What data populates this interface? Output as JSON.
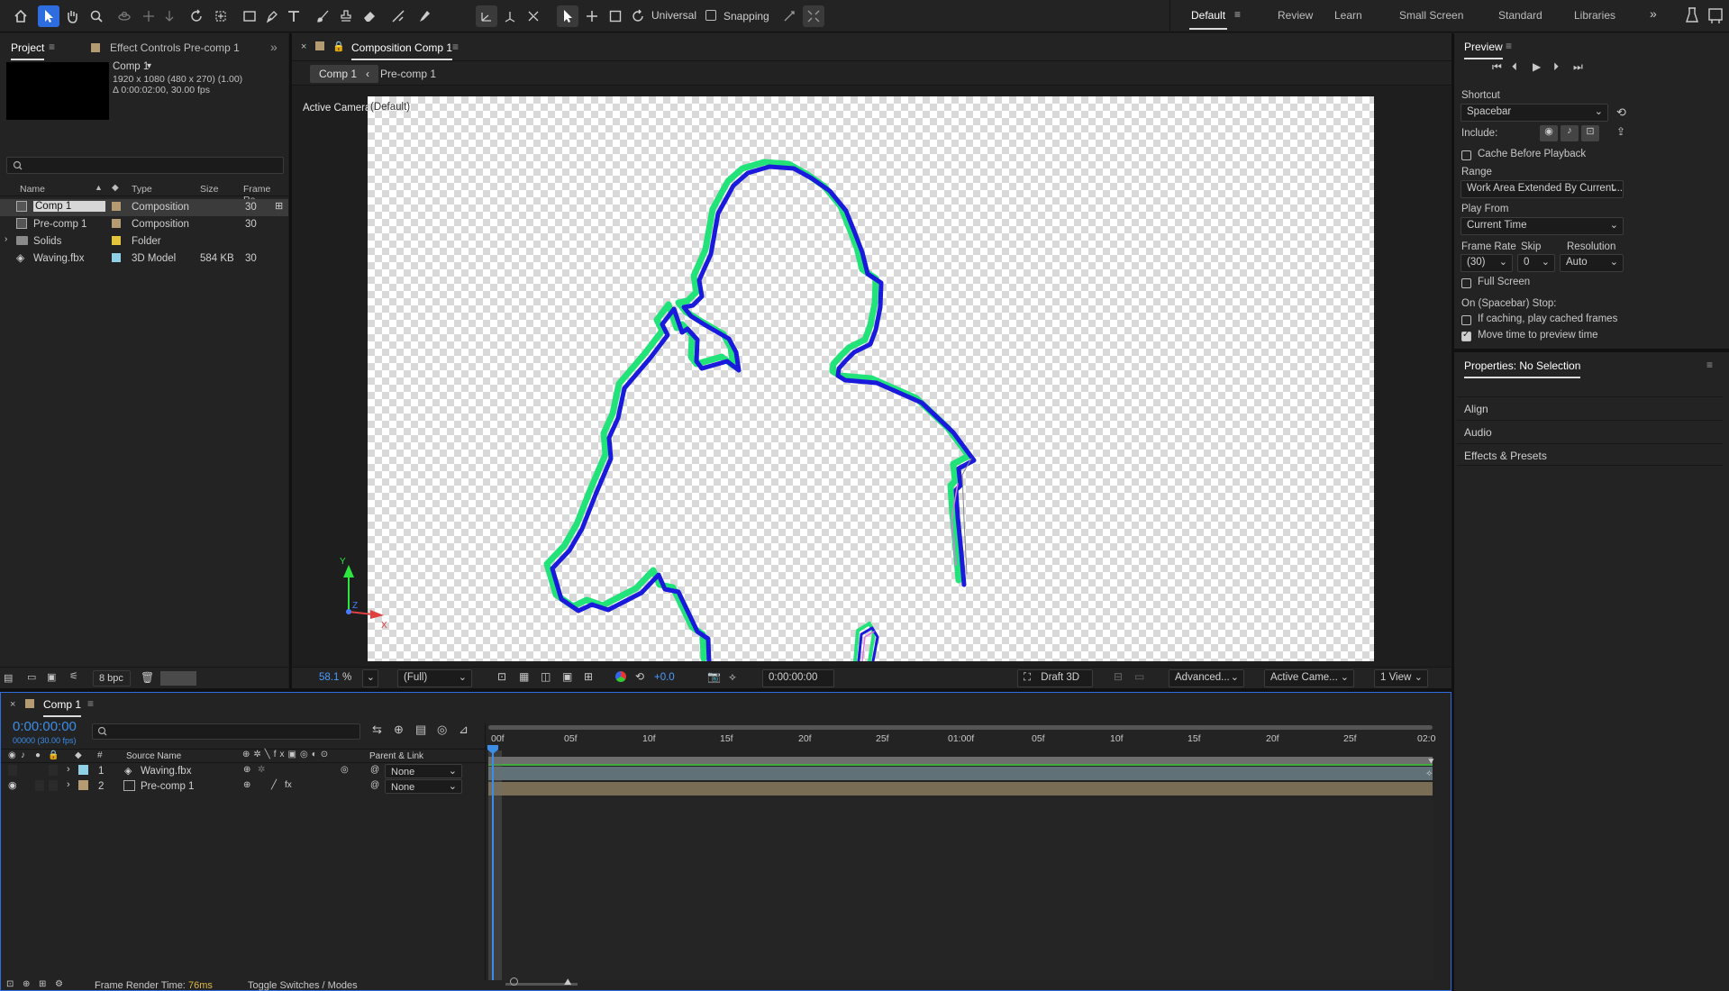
{
  "toolbar": {
    "tool_icons": [
      "home-icon",
      "selection-tool-icon",
      "hand-tool-icon",
      "zoom-tool-icon",
      "orbit-tool-icon",
      "pan-tool-icon",
      "dolly-tool-icon",
      "rotate-tool-icon",
      "pan-behind-tool-icon",
      "rectangle-tool-icon",
      "pen-tool-icon",
      "type-tool-icon",
      "brush-tool-icon",
      "clone-stamp-icon",
      "eraser-icon",
      "roto-brush-icon",
      "puppet-tool-icon"
    ],
    "axis_label": "Universal",
    "snapping_label": "Snapping",
    "workspaces": [
      "Default",
      "Review",
      "Learn",
      "Small Screen",
      "Standard",
      "Libraries"
    ],
    "current_workspace": "Default"
  },
  "project": {
    "tab_label": "Project",
    "effect_controls_label": "Effect Controls Pre-comp 1",
    "comp_name": "Comp 1",
    "comp_res": "1920 x 1080  (480 x 270) (1.00)",
    "comp_dur": "Δ 0:00:02:00, 30.00 fps",
    "columns": {
      "name": "Name",
      "type": "Type",
      "size": "Size",
      "frame_rate": "Frame Ra.."
    },
    "items": [
      {
        "name": "Comp 1",
        "type": "Composition",
        "size": "",
        "fps": "30",
        "color": "#b59b72"
      },
      {
        "name": "Pre-comp 1",
        "type": "Composition",
        "size": "",
        "fps": "30",
        "color": "#b59b72"
      },
      {
        "name": "Solids",
        "type": "Folder",
        "size": "",
        "fps": "",
        "color": "#e3c53c"
      },
      {
        "name": "Waving.fbx",
        "type": "3D Model",
        "size": "584 KB",
        "fps": "30",
        "color": "#8fd0e6"
      }
    ],
    "bpc": "8 bpc"
  },
  "composition": {
    "tab_label": "Composition Comp 1",
    "breadcrumbs": [
      "Comp 1",
      "Pre-comp 1"
    ],
    "camera_label": "Active Camera",
    "camera_sub": "(Default)",
    "zoom": "58.1",
    "zoom_unit": "%",
    "resolution": "(Full)",
    "exposure": "+0.0",
    "timecode": "0:00:00:00",
    "renderer": "Draft 3D",
    "renderer_mode": "Advanced...",
    "camera_select": "Active Came...",
    "view_count": "1 View",
    "axis_x": "X",
    "axis_y": "Y",
    "axis_z": "Z"
  },
  "preview": {
    "title": "Preview",
    "shortcut_label": "Shortcut",
    "shortcut_value": "Spacebar",
    "include_label": "Include:",
    "cache_label": "Cache Before Playback",
    "range_label": "Range",
    "range_value": "Work Area Extended By Current...",
    "play_from_label": "Play From",
    "play_from_value": "Current Time",
    "frame_rate_label": "Frame Rate",
    "skip_label": "Skip",
    "resolution_label": "Resolution",
    "frame_rate_value": "(30)",
    "skip_value": "0",
    "resolution_value": "Auto",
    "full_screen_label": "Full Screen",
    "stop_label": "On (Spacebar) Stop:",
    "if_caching_label": "If caching, play cached frames",
    "move_time_label": "Move time to preview time",
    "cache_checked": false,
    "full_screen_checked": false,
    "if_caching_checked": false,
    "move_time_checked": true
  },
  "properties": {
    "title": "Properties: No Selection",
    "sections": [
      "Align",
      "Audio",
      "Effects & Presets"
    ]
  },
  "timeline": {
    "tab_label": "Comp 1",
    "timecode": "0:00:00:00",
    "frames_info": "00000 (30.00 fps)",
    "source_name_label": "Source Name",
    "parent_label": "Parent & Link",
    "ruler": [
      "00f",
      "05f",
      "10f",
      "15f",
      "20f",
      "25f",
      "01:00f",
      "05f",
      "10f",
      "15f",
      "20f",
      "25f",
      "02:0"
    ],
    "layers": [
      {
        "num": "1",
        "name": "Waving.fbx",
        "parent": "None",
        "color": "#8fd0e6"
      },
      {
        "num": "2",
        "name": "Pre-comp 1",
        "parent": "None",
        "color": "#b59b72"
      }
    ],
    "frame_render_label": "Frame Render Time:",
    "frame_render_value": "76ms",
    "toggle_label": "Toggle Switches / Modes"
  },
  "colors": {
    "accent": "#2d6de0",
    "outline_blue": "#1a1adc",
    "outline_green": "#22e27a",
    "time_blue": "#3b8de8"
  }
}
